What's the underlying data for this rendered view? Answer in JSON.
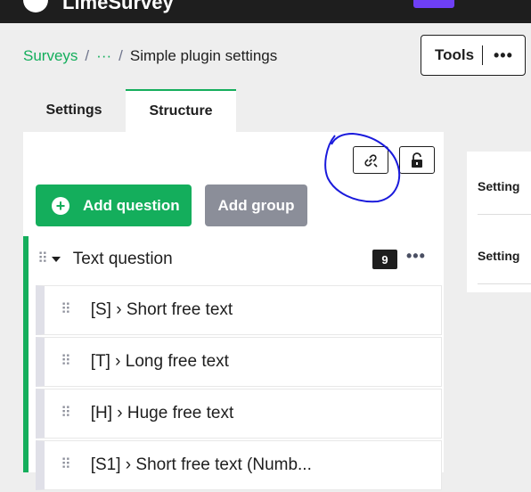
{
  "app": {
    "name": "LimeSurvey"
  },
  "breadcrumb": {
    "root": "Surveys",
    "ellipsis": "···",
    "separator": "/",
    "current": "Simple plugin settings"
  },
  "toolbar": {
    "tools_label": "Tools",
    "more_label": "•••"
  },
  "tabs": [
    {
      "label": "Settings",
      "active": false
    },
    {
      "label": "Structure",
      "active": true
    }
  ],
  "actions": {
    "add_question": "Add question",
    "add_group": "Add group",
    "plus": "+"
  },
  "group": {
    "title": "Text question",
    "count": "9",
    "more": "•••"
  },
  "questions": [
    {
      "label": "[S] › Short free text"
    },
    {
      "label": "[T] › Long free text"
    },
    {
      "label": "[H] › Huge free text"
    },
    {
      "label": "[S1] › Short free text (Numb..."
    }
  ],
  "side_panel": {
    "items": [
      {
        "label": "Setting"
      },
      {
        "label": "Setting"
      }
    ]
  },
  "colors": {
    "accent": "#14ae5c",
    "dark": "#1e1e1e",
    "brand_purple": "#6e3ff5",
    "annotation_blue": "#1a1adc"
  },
  "icons": [
    "logo-icon",
    "relink-icon",
    "unlock-icon",
    "plus-icon",
    "drag-handle-icon",
    "caret-down-icon",
    "more-icon"
  ]
}
